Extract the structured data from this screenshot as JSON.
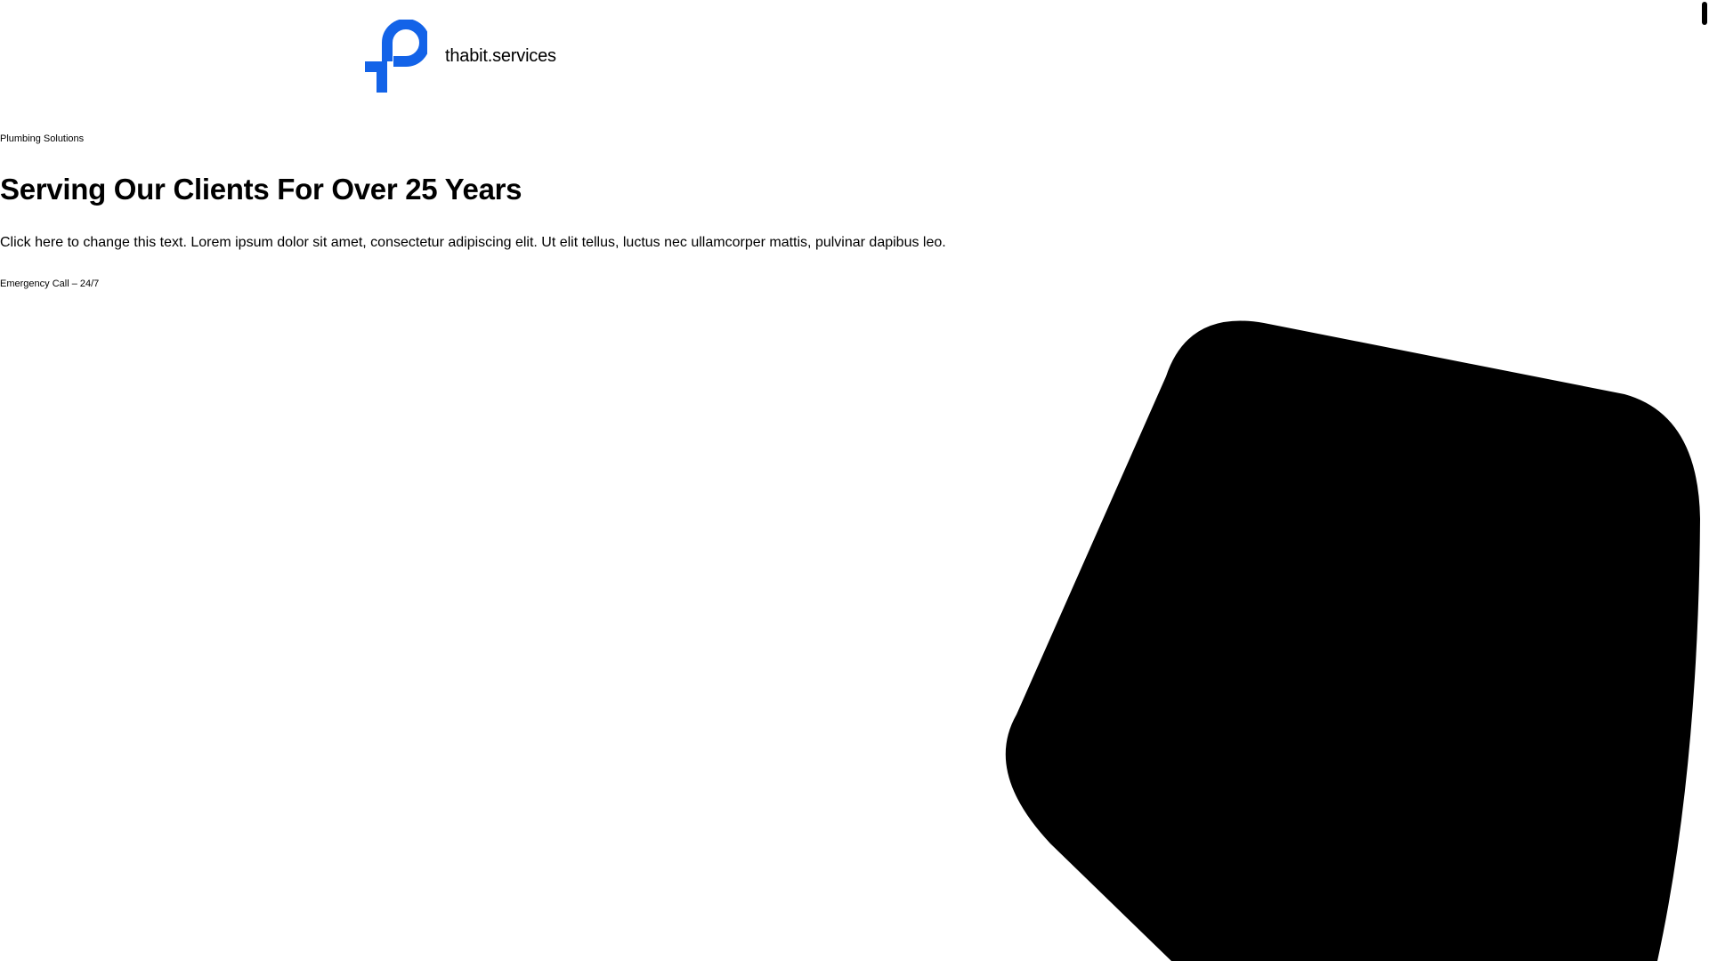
{
  "header": {
    "site_name": "thabit.services",
    "logo_icon": "plumbing-p-logo-icon",
    "brand_color": "#1363e8"
  },
  "hero": {
    "eyebrow": "Plumbing Solutions",
    "title": "Serving Our Clients For Over 25 Years",
    "text": "Click here to change this text. Lorem ipsum dolor sit amet, consectetur adipiscing elit. Ut elit tellus, luctus nec ullamcorper mattis, pulvinar dapibus leo.",
    "cta": "Emergency Call – 24/7",
    "shape_color": "#000000"
  }
}
